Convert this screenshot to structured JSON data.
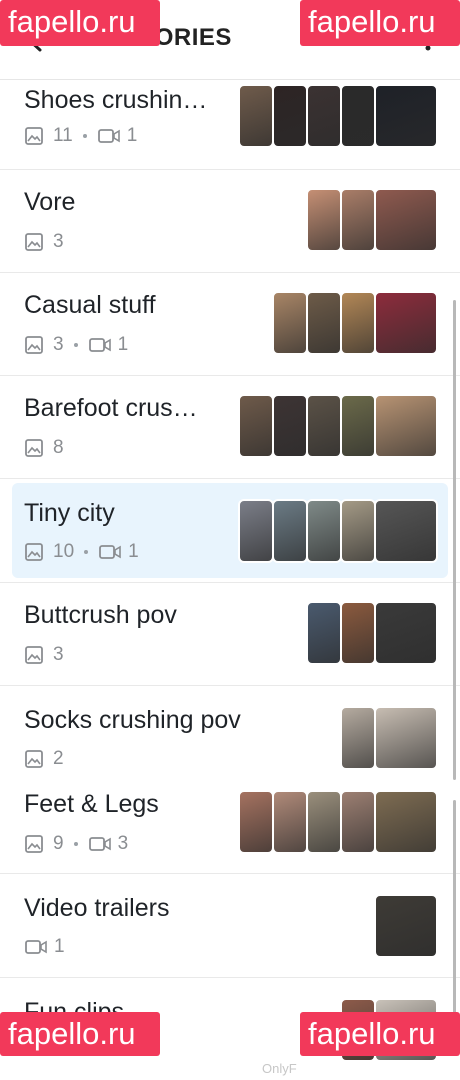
{
  "header": {
    "title": "CATEGORIES"
  },
  "watermark": {
    "text": "fapello.ru"
  },
  "footer": {
    "text": "OnlyF"
  },
  "rows": [
    {
      "name": "Shoes crushin…",
      "images": "11",
      "videos": "1",
      "thumbs": [
        "#6f5b4b",
        "#2d2424",
        "#3b3232",
        "#2a2a2a",
        "#1e2128"
      ]
    },
    {
      "name": "Vore",
      "images": "3",
      "thumbs": [
        "#c58f74",
        "#a97d68",
        "#8f5a4f"
      ]
    },
    {
      "name": "Casual stuff",
      "images": "3",
      "videos": "1",
      "thumbs": [
        "#a88566",
        "#6d5b48",
        "#b28756",
        "#8d2c3c"
      ]
    },
    {
      "name": "Barefoot crus…",
      "images": "8",
      "thumbs": [
        "#6e5a4a",
        "#3d3434",
        "#5b5247",
        "#6b6a4a",
        "#b79373"
      ]
    },
    {
      "name": "Tiny city",
      "images": "10",
      "videos": "1",
      "thumbs": [
        "#7b7e88",
        "#6b7b85",
        "#7f8a88",
        "#a49a86",
        "#565656"
      ]
    },
    {
      "name": "Buttcrush pov",
      "images": "3",
      "thumbs": [
        "#4a5a6e",
        "#8b5a3e",
        "#3a3a3a"
      ]
    },
    {
      "name": "Socks crushing pov",
      "images": "2",
      "thumbs": [
        "#b5aba0",
        "#c7bdb2"
      ]
    },
    {
      "name": "Feet & Legs",
      "images": "9",
      "videos": "3",
      "thumbs": [
        "#a57260",
        "#b08a79",
        "#9a8f7c",
        "#9c7f72",
        "#7e6c52"
      ]
    },
    {
      "name": "Video trailers",
      "videos": "1",
      "thumbs": [
        "#3e3b36"
      ]
    },
    {
      "name": "Fun clips",
      "thumbs": [
        "#8d5b4a",
        "#c9c2b9"
      ]
    }
  ],
  "colors": {
    "accent": "#f2395a",
    "selected_bg": "#e8f4fd",
    "meta": "#8a8d91"
  }
}
